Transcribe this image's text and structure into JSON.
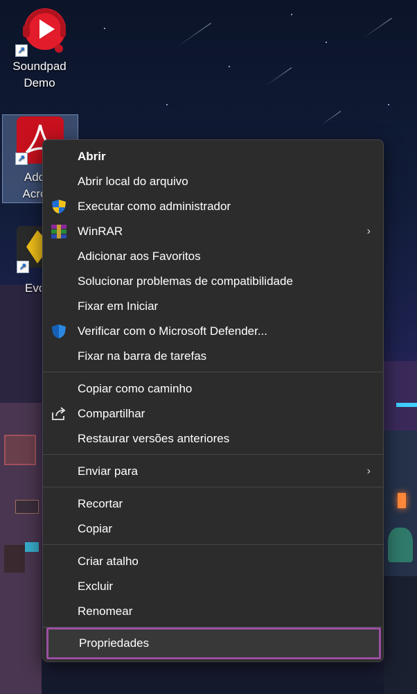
{
  "desktop": {
    "icons": [
      {
        "label": "Soundpad Demo",
        "icon": "soundpad-icon"
      },
      {
        "label": "Ado Acro",
        "icon": "acrobat-icon"
      },
      {
        "label": "Evo",
        "icon": "evo-icon"
      }
    ]
  },
  "menu": {
    "open": "Abrir",
    "open_location": "Abrir local do arquivo",
    "run_admin": "Executar como administrador",
    "winrar": "WinRAR",
    "add_favorites": "Adicionar aos Favoritos",
    "troubleshoot": "Solucionar problemas de compatibilidade",
    "pin_start": "Fixar em Iniciar",
    "defender": "Verificar com o Microsoft Defender...",
    "pin_taskbar": "Fixar na barra de tarefas",
    "copy_path": "Copiar como caminho",
    "share": "Compartilhar",
    "restore": "Restaurar versões anteriores",
    "send_to": "Enviar para",
    "cut": "Recortar",
    "copy": "Copiar",
    "create_shortcut": "Criar atalho",
    "delete": "Excluir",
    "rename": "Renomear",
    "properties": "Propriedades"
  },
  "colors": {
    "menu_bg": "#2c2c2c",
    "highlight_border": "#9b4fa3"
  }
}
